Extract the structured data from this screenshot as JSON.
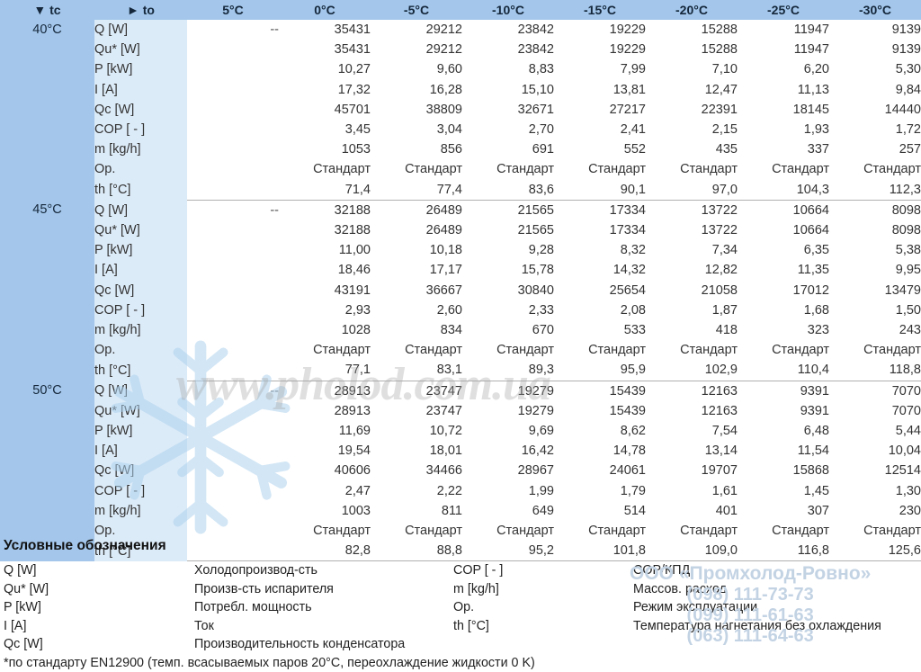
{
  "table": {
    "header": {
      "tc_label": "▼ tc",
      "to_label": "► to",
      "temperatures": [
        "5°C",
        "0°C",
        "-5°C",
        "-10°C",
        "-15°C",
        "-20°C",
        "-25°C",
        "-30°C"
      ]
    },
    "row_labels": [
      "Q [W]",
      "Qu* [W]",
      "P [kW]",
      "I [A]",
      "Qc [W]",
      "COP [ - ]",
      "m [kg/h]",
      "Op.",
      "th [°C]"
    ],
    "blocks": [
      {
        "tc": "40°C",
        "rows": [
          [
            "--",
            "35431",
            "29212",
            "23842",
            "19229",
            "15288",
            "11947",
            "9139"
          ],
          [
            "",
            "35431",
            "29212",
            "23842",
            "19229",
            "15288",
            "11947",
            "9139"
          ],
          [
            "",
            "10,27",
            "9,60",
            "8,83",
            "7,99",
            "7,10",
            "6,20",
            "5,30"
          ],
          [
            "",
            "17,32",
            "16,28",
            "15,10",
            "13,81",
            "12,47",
            "11,13",
            "9,84"
          ],
          [
            "",
            "45701",
            "38809",
            "32671",
            "27217",
            "22391",
            "18145",
            "14440"
          ],
          [
            "",
            "3,45",
            "3,04",
            "2,70",
            "2,41",
            "2,15",
            "1,93",
            "1,72"
          ],
          [
            "",
            "1053",
            "856",
            "691",
            "552",
            "435",
            "337",
            "257"
          ],
          [
            "",
            "Стандарт",
            "Стандарт",
            "Стандарт",
            "Стандарт",
            "Стандарт",
            "Стандарт",
            "Стандарт"
          ],
          [
            "",
            "71,4",
            "77,4",
            "83,6",
            "90,1",
            "97,0",
            "104,3",
            "112,3"
          ]
        ]
      },
      {
        "tc": "45°C",
        "rows": [
          [
            "--",
            "32188",
            "26489",
            "21565",
            "17334",
            "13722",
            "10664",
            "8098"
          ],
          [
            "",
            "32188",
            "26489",
            "21565",
            "17334",
            "13722",
            "10664",
            "8098"
          ],
          [
            "",
            "11,00",
            "10,18",
            "9,28",
            "8,32",
            "7,34",
            "6,35",
            "5,38"
          ],
          [
            "",
            "18,46",
            "17,17",
            "15,78",
            "14,32",
            "12,82",
            "11,35",
            "9,95"
          ],
          [
            "",
            "43191",
            "36667",
            "30840",
            "25654",
            "21058",
            "17012",
            "13479"
          ],
          [
            "",
            "2,93",
            "2,60",
            "2,33",
            "2,08",
            "1,87",
            "1,68",
            "1,50"
          ],
          [
            "",
            "1028",
            "834",
            "670",
            "533",
            "418",
            "323",
            "243"
          ],
          [
            "",
            "Стандарт",
            "Стандарт",
            "Стандарт",
            "Стандарт",
            "Стандарт",
            "Стандарт",
            "Стандарт"
          ],
          [
            "",
            "77,1",
            "83,1",
            "89,3",
            "95,9",
            "102,9",
            "110,4",
            "118,8"
          ]
        ]
      },
      {
        "tc": "50°C",
        "rows": [
          [
            "--",
            "28913",
            "23747",
            "19279",
            "15439",
            "12163",
            "9391",
            "7070"
          ],
          [
            "",
            "28913",
            "23747",
            "19279",
            "15439",
            "12163",
            "9391",
            "7070"
          ],
          [
            "",
            "11,69",
            "10,72",
            "9,69",
            "8,62",
            "7,54",
            "6,48",
            "5,44"
          ],
          [
            "",
            "19,54",
            "18,01",
            "16,42",
            "14,78",
            "13,14",
            "11,54",
            "10,04"
          ],
          [
            "",
            "40606",
            "34466",
            "28967",
            "24061",
            "19707",
            "15868",
            "12514"
          ],
          [
            "",
            "2,47",
            "2,22",
            "1,99",
            "1,79",
            "1,61",
            "1,45",
            "1,30"
          ],
          [
            "",
            "1003",
            "811",
            "649",
            "514",
            "401",
            "307",
            "230"
          ],
          [
            "",
            "Стандарт",
            "Стандарт",
            "Стандарт",
            "Стандарт",
            "Стандарт",
            "Стандарт",
            "Стандарт"
          ],
          [
            "",
            "82,8",
            "88,8",
            "95,2",
            "101,8",
            "109,0",
            "116,8",
            "125,6"
          ]
        ]
      }
    ]
  },
  "legend": {
    "title": "Условные обозначения",
    "entries_left": [
      {
        "symbol": "Q [W]",
        "description": "Холодопроизвод-сть"
      },
      {
        "symbol": "Qu* [W]",
        "description": "Произв-сть испарителя"
      },
      {
        "symbol": "P [kW]",
        "description": "Потребл. мощность"
      },
      {
        "symbol": "I [A]",
        "description": "Ток"
      },
      {
        "symbol": "Qc [W]",
        "description": "Производительность конденсатора"
      }
    ],
    "entries_right": [
      {
        "symbol": "COP [ - ]",
        "description": "COP/КПД"
      },
      {
        "symbol": "m [kg/h]",
        "description": "Массов. расход"
      },
      {
        "symbol": "Op.",
        "description": "Режим эксплуатации"
      },
      {
        "symbol": "th [°C]",
        "description": "Температура нагнетания без охлаждения"
      }
    ],
    "footnote": "*по стандарту EN12900 (темп. всасываемых паров 20°C, переохлаждение жидкости 0 K)"
  },
  "watermarks": {
    "url": "www.pholod.com.ua",
    "company_name": "ООО «Промхолод-Ровно»",
    "phones": [
      "(098) 111-73-73",
      "(099) 111-61-63",
      "(063) 111-64-63"
    ]
  },
  "colors": {
    "header_blue": "#a3c6ea",
    "tc_blue": "#a3c6ea",
    "to_blue": "#dcebf8",
    "watermark_blue": "#c3d3e4"
  }
}
